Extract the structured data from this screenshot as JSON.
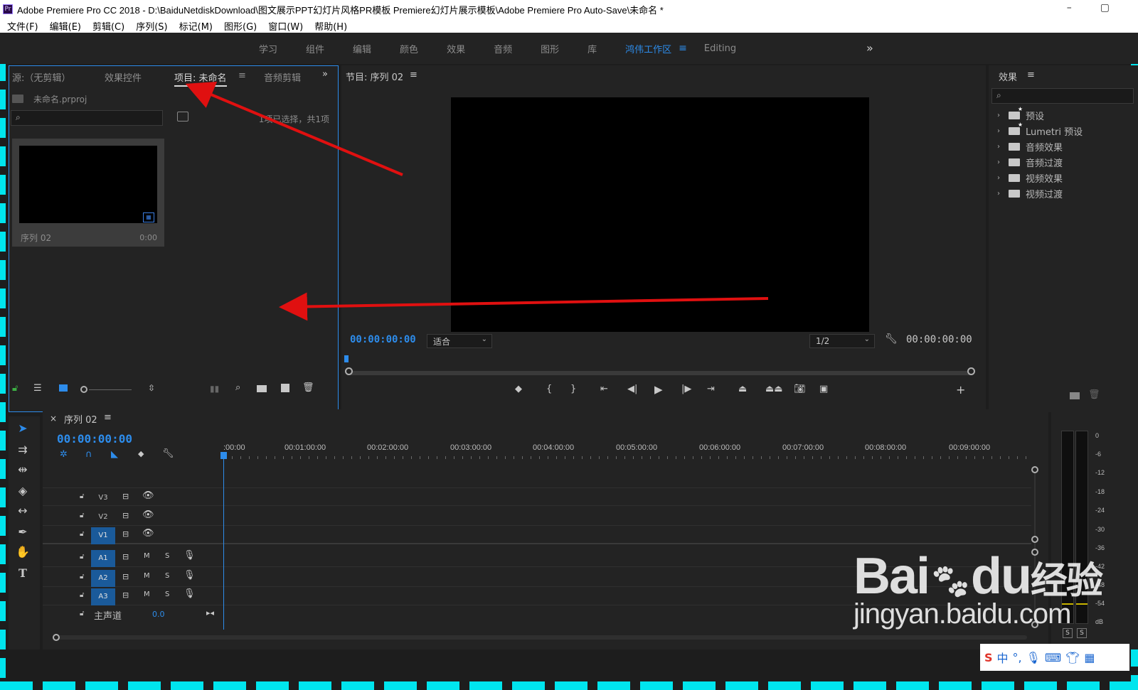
{
  "window": {
    "title": "Adobe Premiere Pro CC 2018 - D:\\BaiduNetdiskDownload\\图文展示PPT幻灯片风格PR模板 Premiere幻灯片展示模板\\Adobe Premiere Pro Auto-Save\\未命名 *",
    "app_icon": "Pr",
    "minimize": "–",
    "maximize": "▢"
  },
  "menu": [
    "文件(F)",
    "编辑(E)",
    "剪辑(C)",
    "序列(S)",
    "标记(M)",
    "图形(G)",
    "窗口(W)",
    "帮助(H)"
  ],
  "workspaces": {
    "items": [
      "学习",
      "组件",
      "编辑",
      "颜色",
      "效果",
      "音频",
      "图形",
      "库"
    ],
    "active": "鸿伟工作区",
    "menu_glyph": "≡",
    "extra": "Editing",
    "more_glyph": "»"
  },
  "project_panel": {
    "tabs": [
      "源:（无剪辑）",
      "效果控件",
      "项目: 未命名",
      "音频剪辑"
    ],
    "active_tab_index": 2,
    "tab_menu_glyph": "≡",
    "more_glyph": "»",
    "file_name": "未命名.prproj",
    "selection_status": "1项已选择，共1项",
    "item": {
      "name": "序列 02",
      "duration": "0:00"
    }
  },
  "program_panel": {
    "title": "节目: 序列 02",
    "menu_glyph": "≡",
    "timecode_left": "00:00:00:00",
    "fit_dropdown": "适合",
    "resolution_dropdown": "1/2",
    "timecode_right": "00:00:00:00"
  },
  "effects_panel": {
    "title": "效果",
    "menu_glyph": "≡",
    "items": [
      "预设",
      "Lumetri 预设",
      "音频效果",
      "音频过渡",
      "视频效果",
      "视频过渡"
    ]
  },
  "timeline": {
    "close_glyph": "×",
    "sequence_name": "序列 02",
    "menu_glyph": "≡",
    "timecode": "00:00:00:00",
    "ruler": [
      ":00:00",
      "00:01:00:00",
      "00:02:00:00",
      "00:03:00:00",
      "00:04:00:00",
      "00:05:00:00",
      "00:06:00:00",
      "00:07:00:00",
      "00:08:00:00",
      "00:09:00:00"
    ],
    "video_tracks": [
      "V3",
      "V2",
      "V1"
    ],
    "audio_tracks": [
      "A1",
      "A2",
      "A3"
    ],
    "mute_label": "M",
    "solo_label": "S",
    "master_label": "主声道",
    "master_value": "0.0"
  },
  "meters": {
    "db_labels": [
      "0",
      "-6",
      "-12",
      "-18",
      "-24",
      "-30",
      "-36",
      "-42",
      "-48",
      "-54",
      "dB"
    ],
    "solo_labels": [
      "S",
      "S"
    ]
  },
  "watermark": {
    "brand_left": "Bai",
    "brand_mid": "du",
    "brand_cn": "经验",
    "url": "jingyan.baidu.com"
  },
  "tray": {
    "ime": "中",
    "punct": "°,"
  }
}
